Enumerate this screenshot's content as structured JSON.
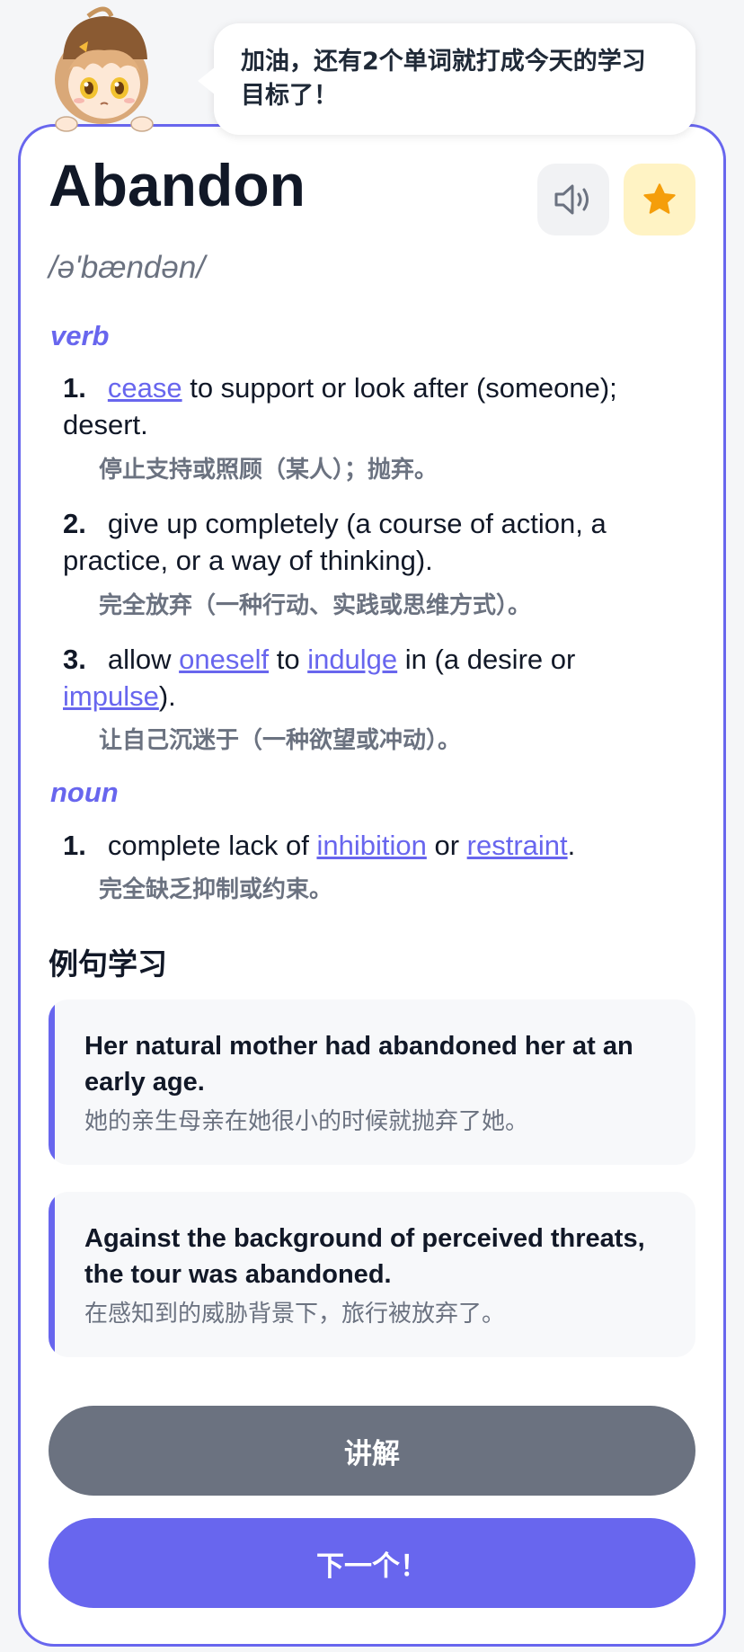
{
  "bubble": {
    "message": "加油，还有2个单词就打成今天的学习目标了！"
  },
  "word": {
    "headword": "Abandon",
    "phonetic": "/ə'bændən/"
  },
  "actions": {
    "speaker_icon": "speaker-icon",
    "star_icon": "star-icon",
    "star_color": "#f59e0b"
  },
  "verb": {
    "label": "verb",
    "defs": [
      {
        "num": "1.",
        "link1": "cease",
        "text1": " to support or look after (someone); desert.",
        "zh": "停止支持或照顾（某人）；抛弃。"
      },
      {
        "num": "2.",
        "text1": "give up completely (a course of action, a practice, or a way of thinking).",
        "zh": "完全放弃（一种行动、实践或思维方式）。"
      },
      {
        "num": "3.",
        "text1": "allow ",
        "link1": "oneself",
        "text2": " to ",
        "link2": "indulge",
        "text3": " in (a desire or ",
        "link3": "impulse",
        "text4": ").",
        "zh": "让自己沉迷于（一种欲望或冲动）。"
      }
    ]
  },
  "noun": {
    "label": "noun",
    "defs": [
      {
        "num": "1.",
        "text1": "complete lack of ",
        "link1": "inhibition",
        "text2": " or ",
        "link2": "restraint",
        "text3": ".",
        "zh": "完全缺乏抑制或约束。"
      }
    ]
  },
  "examples": {
    "title": "例句学习",
    "items": [
      {
        "en": "Her natural mother had abandoned her at an early age.",
        "zh": "她的亲生母亲在她很小的时候就抛弃了她。"
      },
      {
        "en": "Against the background of perceived threats, the tour was abandoned.",
        "zh": "在感知到的威胁背景下，旅行被放弃了。"
      }
    ]
  },
  "buttons": {
    "explain": "讲解",
    "next": "下一个！"
  },
  "colors": {
    "accent": "#6866ee",
    "gray_button": "#6b7280"
  }
}
